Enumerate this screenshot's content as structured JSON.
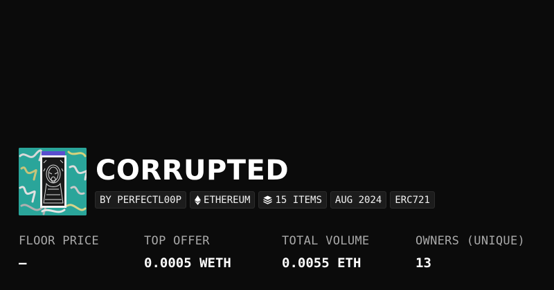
{
  "collection": {
    "title": "CORRUPTED",
    "badges": {
      "creator": "BY PERFECTL00P",
      "chain": "ETHEREUM",
      "items": "15 ITEMS",
      "date": "AUG 2024",
      "standard": "ERC721"
    },
    "chain_icon": "ethereum-icon",
    "items_icon": "layers-icon"
  },
  "stats": {
    "floor_price": {
      "label": "FLOOR PRICE",
      "value": "—"
    },
    "top_offer": {
      "label": "TOP OFFER",
      "value": "0.0005 WETH"
    },
    "total_volume": {
      "label": "TOTAL VOLUME",
      "value": "0.0055 ETH"
    },
    "owners": {
      "label": "OWNERS (UNIQUE)",
      "value": "13"
    }
  },
  "colors": {
    "background": "#0b0b0b",
    "thumbnail_teal": "#2aa59a",
    "badge_bg": "#1c1c1c",
    "label_gray": "#a9a9a9"
  }
}
